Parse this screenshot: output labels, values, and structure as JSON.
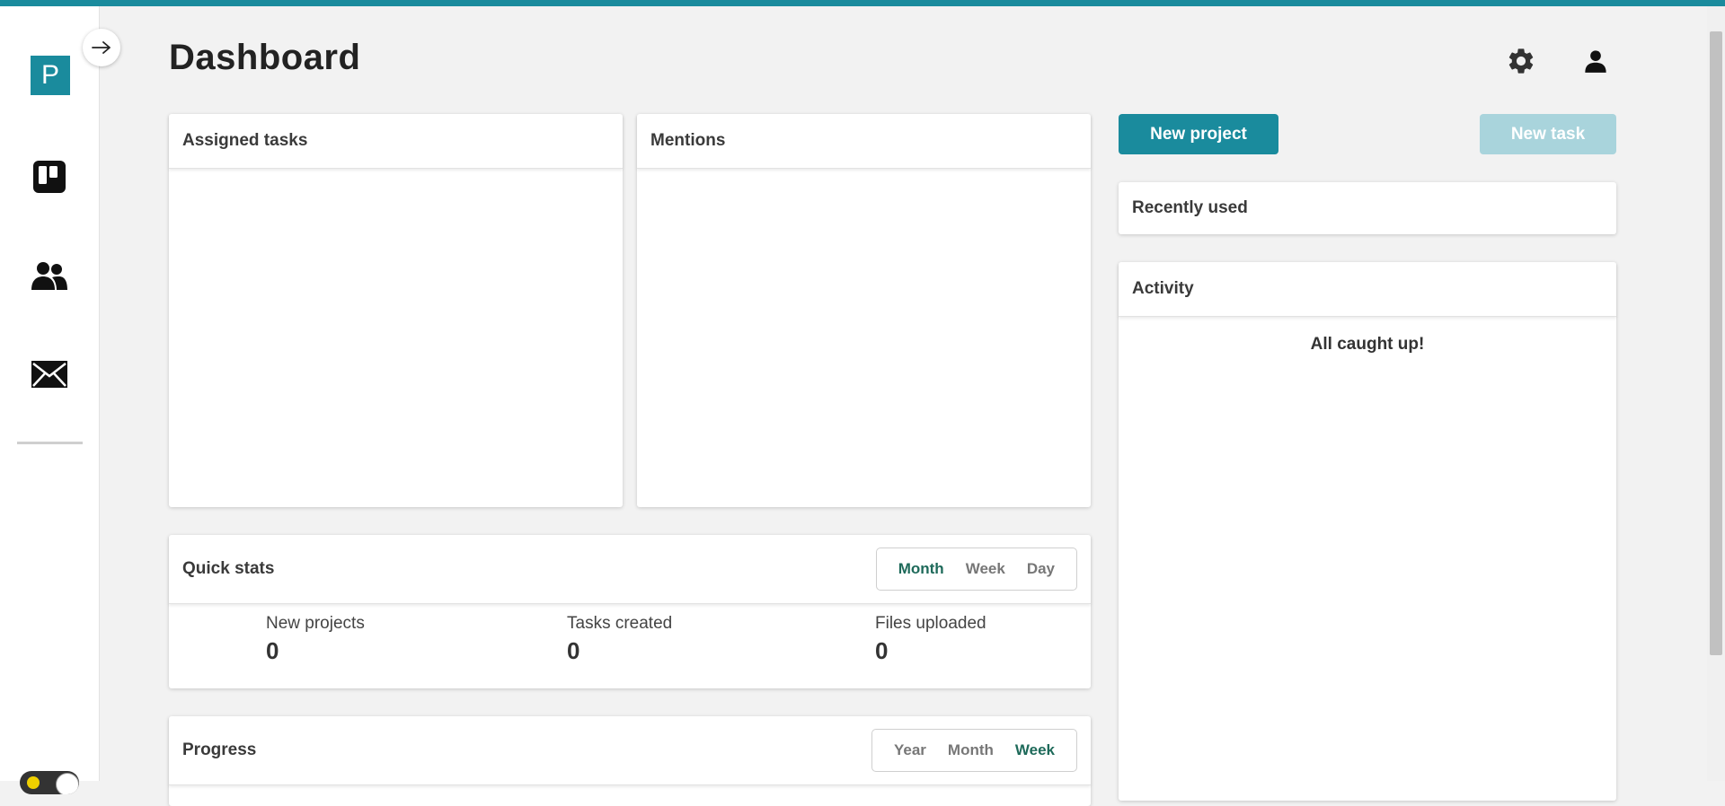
{
  "app": {
    "logo_letter": "P",
    "accent_color": "#1a8b9d"
  },
  "sidebar": {
    "collapse_toggle_icon": "arrow-right-icon",
    "items": [
      {
        "icon": "board-icon",
        "label": ""
      },
      {
        "icon": "people-icon",
        "label": ""
      },
      {
        "icon": "mail-icon",
        "label": ""
      }
    ],
    "theme_toggle": {
      "icon": "sun-icon"
    }
  },
  "header": {
    "title": "Dashboard",
    "settings_icon": "gear-icon",
    "profile_icon": "user-icon"
  },
  "actions": {
    "new_project": "New project",
    "new_task": "New task"
  },
  "cards": {
    "assigned_tasks": {
      "title": "Assigned tasks"
    },
    "mentions": {
      "title": "Mentions"
    },
    "recently_used": {
      "title": "Recently used"
    },
    "activity": {
      "title": "Activity",
      "empty_message": "All caught up!"
    },
    "quick_stats": {
      "title": "Quick stats",
      "periods": [
        "Month",
        "Week",
        "Day"
      ],
      "active_period": "Month",
      "stats": [
        {
          "label": "New projects",
          "value": "0"
        },
        {
          "label": "Tasks created",
          "value": "0"
        },
        {
          "label": "Files uploaded",
          "value": "0"
        }
      ]
    },
    "progress": {
      "title": "Progress",
      "periods": [
        "Year",
        "Month",
        "Week"
      ],
      "active_period": "Week"
    }
  }
}
